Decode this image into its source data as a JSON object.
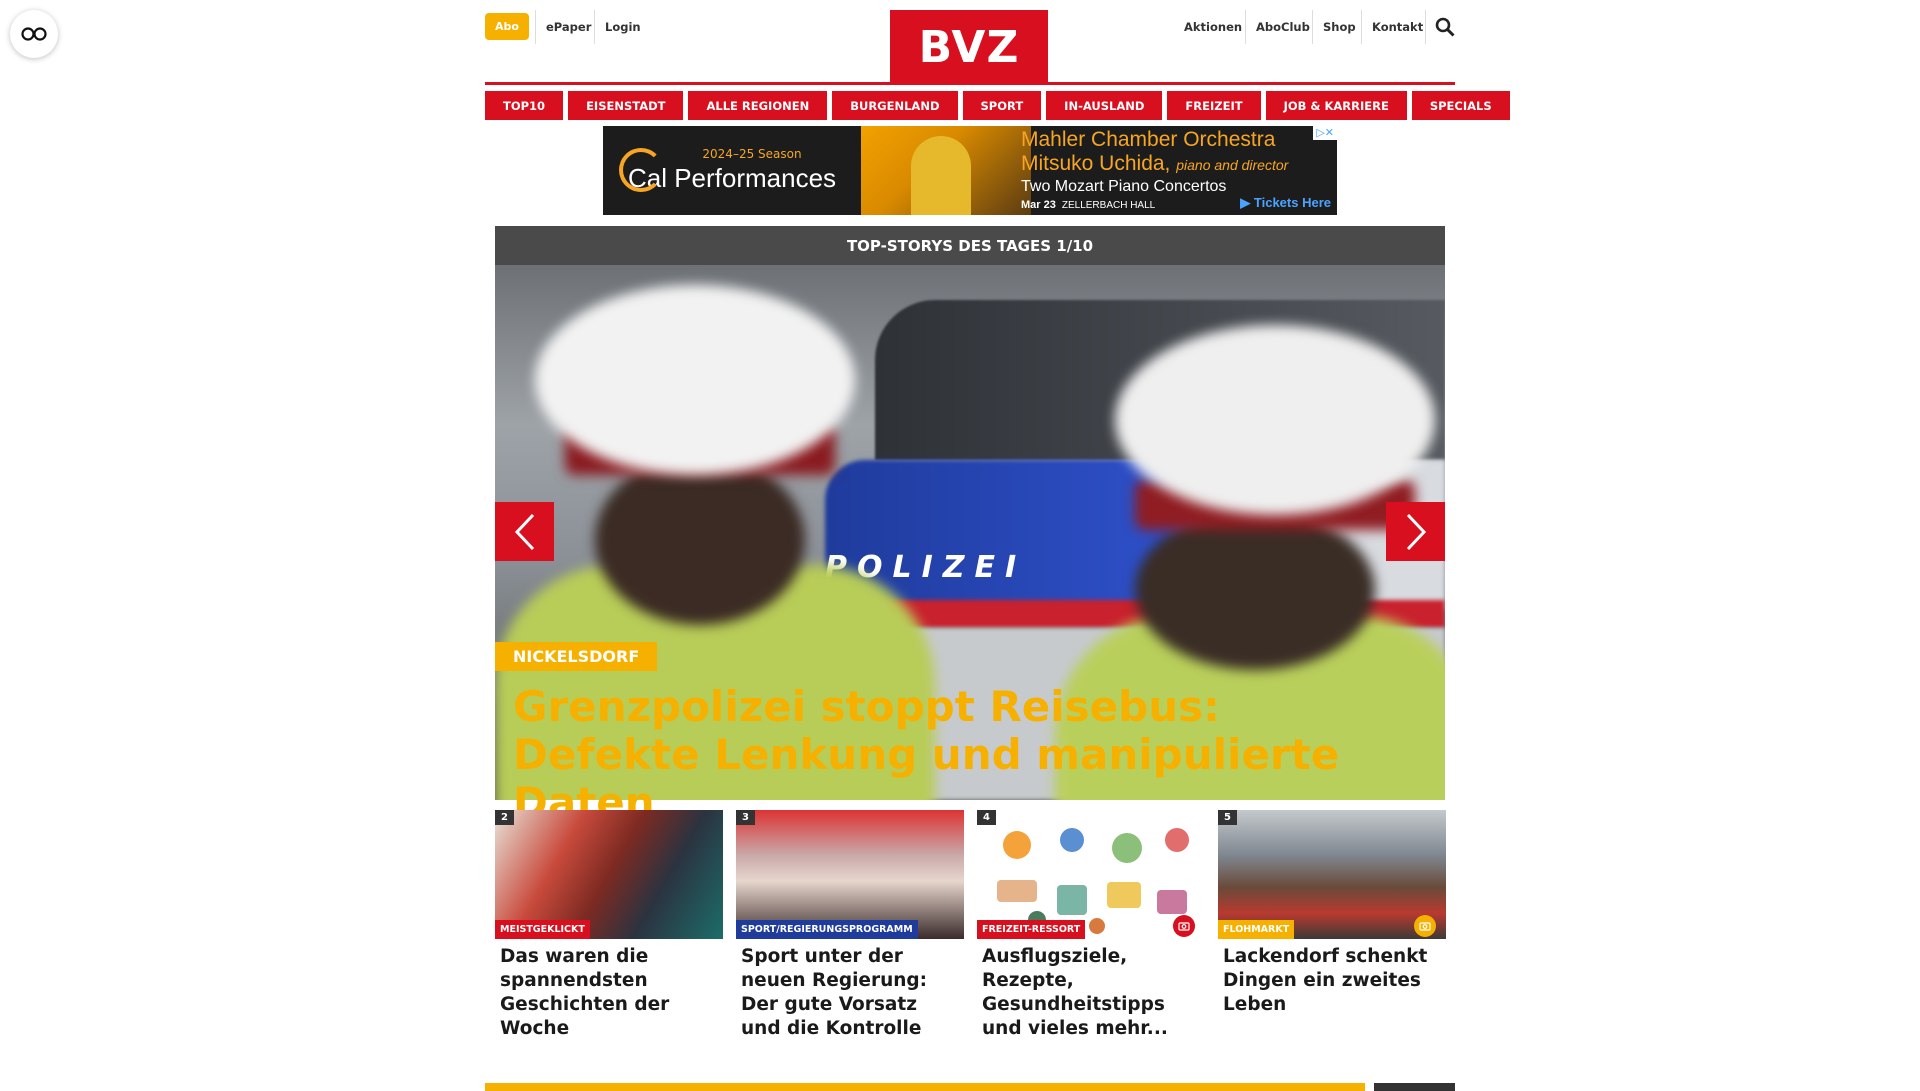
{
  "header": {
    "abo_label": "Abo",
    "epaper_label": "ePaper",
    "login_label": "Login",
    "logo_text": "BVZ",
    "aktionen_label": "Aktionen",
    "aboclub_label": "AboClub",
    "shop_label": "Shop",
    "kontakt_label": "Kontakt"
  },
  "nav": {
    "items": [
      {
        "label": "TOP10"
      },
      {
        "label": "EISENSTADT"
      },
      {
        "label": "ALLE REGIONEN"
      },
      {
        "label": "BURGENLAND"
      },
      {
        "label": "SPORT"
      },
      {
        "label": "IN-AUSLAND"
      },
      {
        "label": "FREIZEIT"
      },
      {
        "label": "JOB & KARRIERE"
      },
      {
        "label": "SPECIALS"
      }
    ]
  },
  "ad": {
    "season": "2024–25 Season",
    "brand": "Cal Performances",
    "line1": "Mahler Chamber Orchestra",
    "line2": "Mitsuko Uchida,",
    "line2_role": "piano and director",
    "line3": "Two Mozart Piano Concertos",
    "date": "Mar 23",
    "hall": "ZELLERBACH HALL",
    "cta": "▶ Tickets Here"
  },
  "hero": {
    "header": "TOP-STORYS DES TAGES 1/10",
    "tag": "NICKELSDORF",
    "title": "Grenzpolizei stoppt Reisebus: Defekte Lenkung und manipulierte Daten",
    "image_text": "POLIZEI"
  },
  "cards": [
    {
      "num": "2",
      "category": "MEISTGEKLICKT",
      "cat_color": "#d70f1e",
      "title": "Das waren die spannendsten Geschichten der Woche"
    },
    {
      "num": "3",
      "category": "SPORT/REGIERUNGSPROGRAMM",
      "cat_color": "#1f3b9c",
      "title": "Sport unter der neuen Regierung: Der gute Vorsatz und die Kontrolle"
    },
    {
      "num": "4",
      "category": "FREIZEIT-RESSORT",
      "cat_color": "#d70f1e",
      "title": "Ausflugsziele, Rezepte, Gesundheitstipps und vieles mehr..."
    },
    {
      "num": "5",
      "category": "FLOHMARKT",
      "cat_color": "#f6b100",
      "title": "Lackendorf schenkt Dingen ein zweites Leben"
    }
  ],
  "colors": {
    "brand_red": "#d70f1e",
    "accent_yellow": "#f6b100",
    "header_gray": "#4a4a4a"
  }
}
